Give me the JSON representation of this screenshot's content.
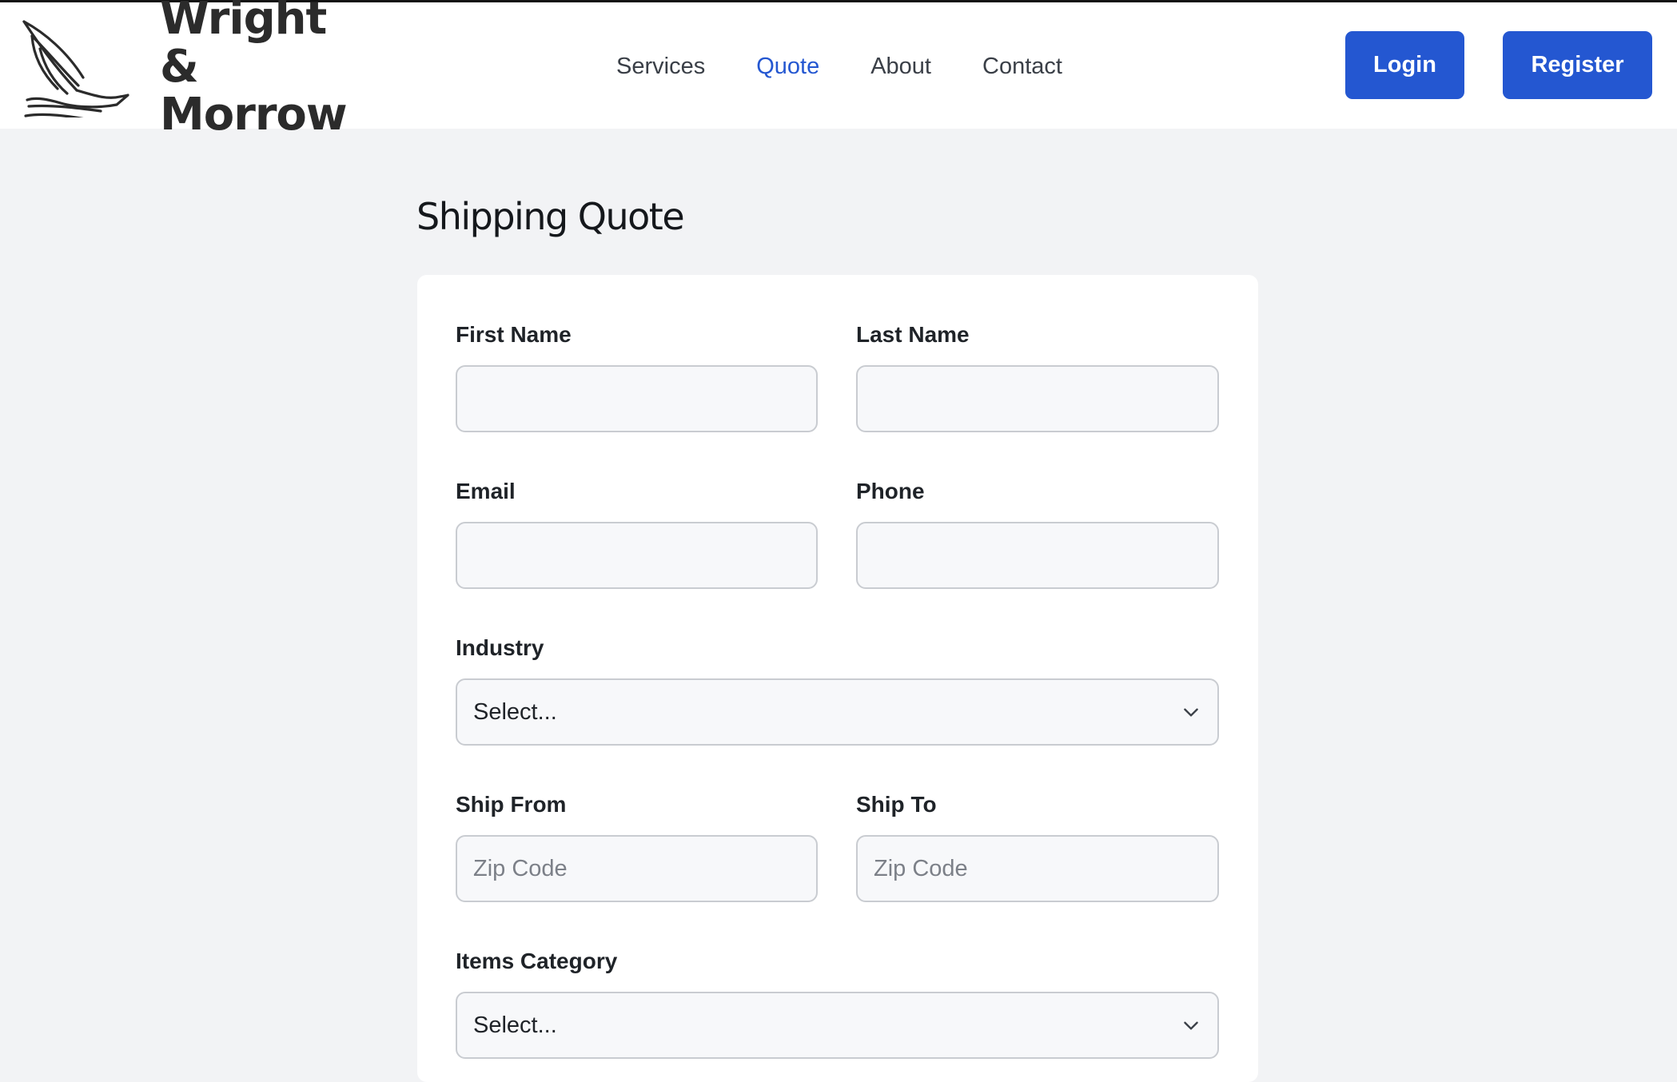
{
  "brand": {
    "name_line1": "Wright &",
    "name_line2": "Morrow",
    "logo_icon": "bird-icon"
  },
  "nav": {
    "items": [
      {
        "label": "Services",
        "active": false
      },
      {
        "label": "Quote",
        "active": true
      },
      {
        "label": "About",
        "active": false
      },
      {
        "label": "Contact",
        "active": false
      }
    ]
  },
  "auth": {
    "login_label": "Login",
    "register_label": "Register"
  },
  "page": {
    "title": "Shipping Quote"
  },
  "form": {
    "first_name": {
      "label": "First Name",
      "value": "",
      "placeholder": ""
    },
    "last_name": {
      "label": "Last Name",
      "value": "",
      "placeholder": ""
    },
    "email": {
      "label": "Email",
      "value": "",
      "placeholder": ""
    },
    "phone": {
      "label": "Phone",
      "value": "",
      "placeholder": ""
    },
    "industry": {
      "label": "Industry",
      "selected": "Select..."
    },
    "ship_from": {
      "label": "Ship From",
      "value": "",
      "placeholder": "Zip Code"
    },
    "ship_to": {
      "label": "Ship To",
      "value": "",
      "placeholder": "Zip Code"
    },
    "items_category": {
      "label": "Items Category",
      "selected": "Select..."
    }
  },
  "colors": {
    "accent": "#2457d1",
    "background": "#f2f3f5",
    "card": "#ffffff"
  }
}
